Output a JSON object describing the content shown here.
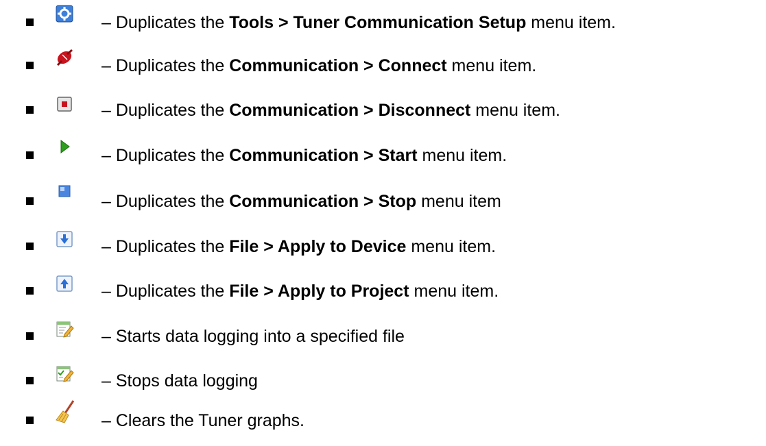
{
  "items": [
    {
      "icon": "tuner-setup-gear-icon",
      "prefix": "– Duplicates the ",
      "bold": "Tools > Tuner Communication Setup",
      "suffix": " menu item."
    },
    {
      "icon": "connect-plug-icon",
      "prefix": "– Duplicates the ",
      "bold": "Communication > Connect",
      "suffix": " menu item."
    },
    {
      "icon": "disconnect-icon",
      "prefix": "– Duplicates the ",
      "bold": "Communication > Disconnect",
      "suffix": " menu item."
    },
    {
      "icon": "start-play-icon",
      "prefix": "– Duplicates the ",
      "bold": "Communication > Start",
      "suffix": " menu item."
    },
    {
      "icon": "stop-square-icon",
      "prefix": "– Duplicates the ",
      "bold": "Communication > Stop",
      "suffix": " menu item"
    },
    {
      "icon": "apply-to-device-icon",
      "prefix": "– Duplicates the ",
      "bold": "File > Apply to Device",
      "suffix": " menu item."
    },
    {
      "icon": "apply-to-project-icon",
      "prefix": "– Duplicates the ",
      "bold": "File > Apply to Project",
      "suffix": " menu item."
    },
    {
      "icon": "start-logging-icon",
      "prefix": "– Starts data logging into a specified file",
      "bold": "",
      "suffix": ""
    },
    {
      "icon": "stop-logging-icon",
      "prefix": "– Stops data logging",
      "bold": "",
      "suffix": ""
    },
    {
      "icon": "clear-graphs-broom-icon",
      "prefix": "– Clears the Tuner graphs.",
      "bold": "",
      "suffix": ""
    }
  ],
  "colors": {
    "text": "#000000",
    "accent_blue": "#2a6fd6",
    "connect_red": "#c8141e",
    "play_green": "#2f9e1f"
  }
}
